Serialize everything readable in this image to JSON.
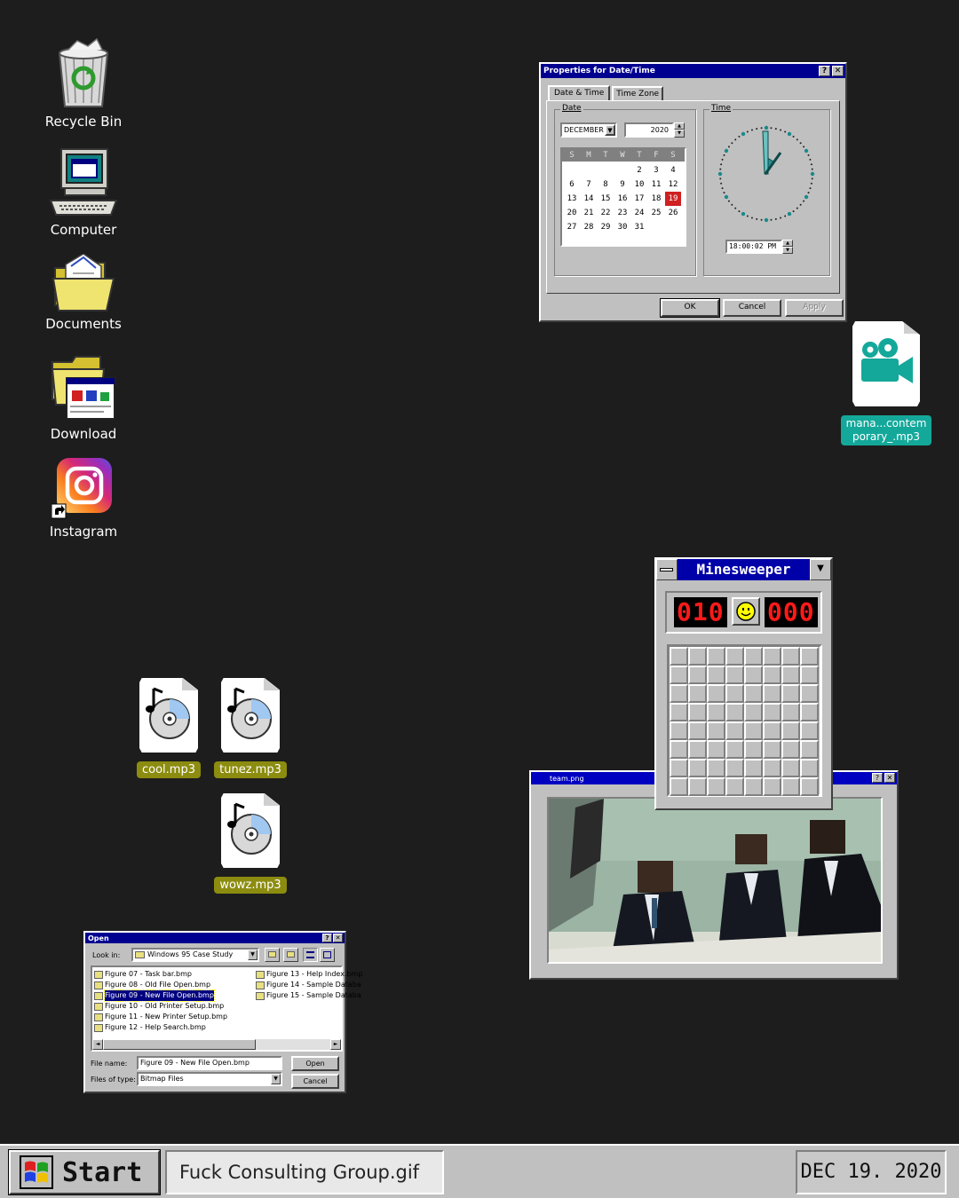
{
  "desktop_icons": [
    {
      "label": "Recycle Bin",
      "icon": "recycle-bin-icon"
    },
    {
      "label": "Computer",
      "icon": "computer-icon"
    },
    {
      "label": "Documents",
      "icon": "documents-folder-icon"
    },
    {
      "label": "Download",
      "icon": "download-folder-icon"
    },
    {
      "label": "Instagram",
      "icon": "instagram-icon"
    }
  ],
  "files": [
    {
      "label": "cool.mp3",
      "icon": "cd-music-icon"
    },
    {
      "label": "tunez.mp3",
      "icon": "cd-music-icon"
    },
    {
      "label": "wowz.mp3",
      "icon": "cd-music-icon"
    },
    {
      "label": "mana...contem porary_.mp3",
      "line1": "mana...contem",
      "line2": "porary_.mp3",
      "icon": "video-camera-icon"
    }
  ],
  "datetime_dialog": {
    "title": "Properties for Date/Time",
    "tabs": [
      "Date & Time",
      "Time Zone"
    ],
    "date_group": "Date",
    "time_group": "Time",
    "month": "DECEMBER",
    "year": "2020",
    "weekdays": [
      "S",
      "M",
      "T",
      "W",
      "T",
      "F",
      "S"
    ],
    "weeks": [
      [
        "",
        "",
        "",
        "",
        "2",
        "3",
        "4"
      ],
      [
        "6",
        "7",
        "8",
        "9",
        "10",
        "11",
        "12"
      ],
      [
        "13",
        "14",
        "15",
        "16",
        "17",
        "18",
        "19"
      ],
      [
        "20",
        "21",
        "22",
        "23",
        "24",
        "25",
        "26"
      ],
      [
        "27",
        "28",
        "29",
        "30",
        "31",
        "",
        ""
      ]
    ],
    "selected_day": "19",
    "time": "18:00:02 PM",
    "buttons": {
      "ok": "OK",
      "cancel": "Cancel",
      "apply": "Apply"
    }
  },
  "minesweeper": {
    "title": "Minesweeper",
    "mines_counter": "010",
    "timer": "000",
    "face": "smiley-face-icon",
    "rows": 8,
    "cols": 8
  },
  "image_window": {
    "title": "team.png"
  },
  "open_dialog": {
    "title": "Open",
    "look_in_label": "Look in:",
    "look_in_value": "Windows 95 Case Study",
    "files_left": [
      "Figure 07 - Task bar.bmp",
      "Figure 08 - Old File Open.bmp",
      "Figure 09 - New File Open.bmp",
      "Figure 10 - Old Printer Setup.bmp",
      "Figure 11 - New Printer Setup.bmp",
      "Figure 12 - Help Search.bmp"
    ],
    "files_right": [
      "Figure 13 - Help Index.bmp",
      "Figure 14 - Sample Databa",
      "Figure 15 - Sample Databa"
    ],
    "selected_file": "Figure 09 - New File Open.bmp",
    "file_name_label": "File name:",
    "file_name_value": "Figure 09 - New File Open.bmp",
    "file_type_label": "Files of type:",
    "file_type_value": "Bitmap Files",
    "open_button": "Open",
    "cancel_button": "Cancel"
  },
  "taskbar": {
    "start_label": "Start",
    "task_label": "Fuck Consulting Group.gif",
    "clock": "DEC 19. 2020"
  },
  "colors": {
    "desktop": "#1d1d1d",
    "titlebar": "#000090",
    "window": "#c0c0c0",
    "file_tag": "#8c8c10",
    "video_tag": "#14a89a",
    "led": "#ff1a1a"
  }
}
